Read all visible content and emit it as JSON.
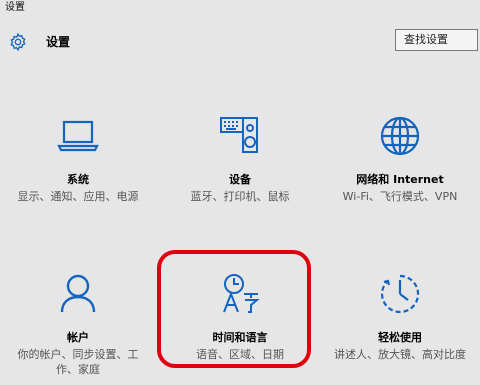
{
  "window": {
    "title": "设置"
  },
  "header": {
    "title": "设置",
    "search_placeholder": "查找设置"
  },
  "colors": {
    "accent": "#1565c0",
    "highlight": "#e1000f",
    "background": "#e6e6e6"
  },
  "tiles": [
    {
      "icon": "laptop-icon",
      "label": "系统",
      "desc": "显示、通知、应用、电源"
    },
    {
      "icon": "keyboard-speaker-icon",
      "label": "设备",
      "desc": "蓝牙、打印机、鼠标"
    },
    {
      "icon": "globe-icon",
      "label": "网络和 Internet",
      "desc": "Wi-Fi、飞行模式、VPN"
    },
    {
      "icon": "person-icon",
      "label": "帐户",
      "desc": "你的帐户、同步设置、工作、家庭"
    },
    {
      "icon": "clock-language-icon",
      "label": "时间和语言",
      "desc": "语音、区域、日期"
    },
    {
      "icon": "timer-accessibility-icon",
      "label": "轻松使用",
      "desc": "讲述人、放大镜、高对比度"
    }
  ]
}
